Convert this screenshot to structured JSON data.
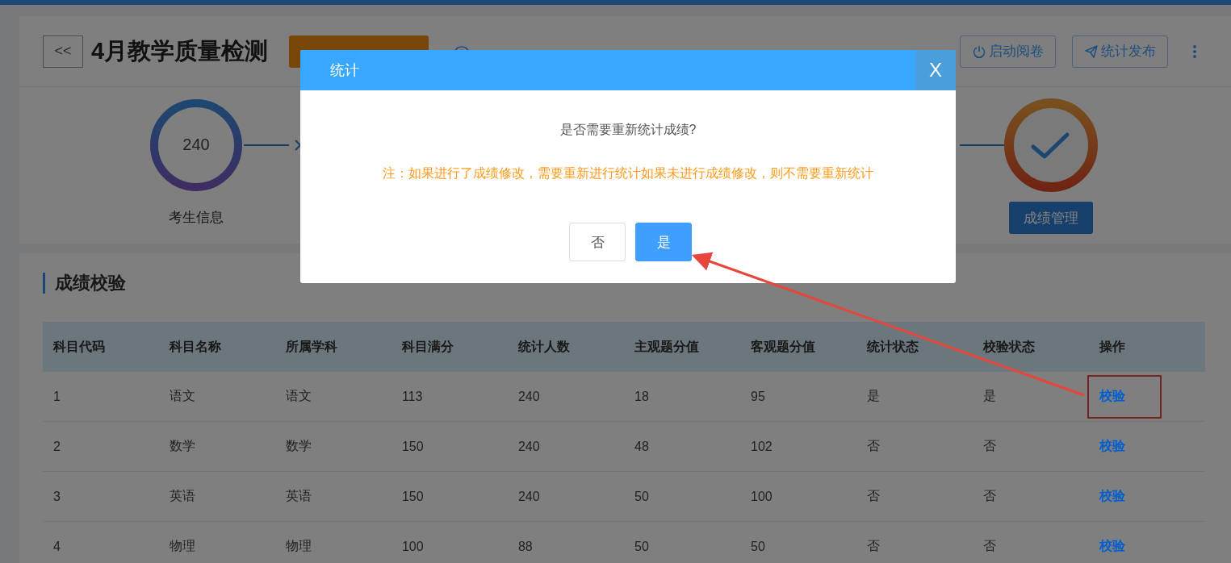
{
  "header": {
    "back_button": "<<",
    "title": "4月教学质量检测",
    "actions": [
      {
        "kind": "power",
        "label": "启动阅卷"
      },
      {
        "kind": "send",
        "label": "统计发布"
      }
    ]
  },
  "steps": [
    {
      "kind": "count",
      "value": "240",
      "label": "考生信息"
    },
    {
      "kind": "done",
      "button": "成绩管理"
    }
  ],
  "section_title": "成绩校验",
  "table": {
    "columns": [
      "科目代码",
      "科目名称",
      "所属学科",
      "科目满分",
      "统计人数",
      "主观题分值",
      "客观题分值",
      "统计状态",
      "校验状态",
      "操作"
    ],
    "rows": [
      {
        "cells": [
          "1",
          "语文",
          "语文",
          "113",
          "240",
          "18",
          "95",
          "是",
          "是"
        ],
        "action": "校验",
        "highlighted": true
      },
      {
        "cells": [
          "2",
          "数学",
          "数学",
          "150",
          "240",
          "48",
          "102",
          "否",
          "否"
        ],
        "action": "校验",
        "highlighted": false
      },
      {
        "cells": [
          "3",
          "英语",
          "英语",
          "150",
          "240",
          "50",
          "100",
          "否",
          "否"
        ],
        "action": "校验",
        "highlighted": false
      },
      {
        "cells": [
          "4",
          "物理",
          "物理",
          "100",
          "88",
          "50",
          "50",
          "否",
          "否"
        ],
        "action": "校验",
        "highlighted": false
      }
    ]
  },
  "dialog": {
    "title": "统计",
    "close": "X",
    "question": "是否需要重新统计成绩?",
    "note": "注：如果进行了成绩修改，需要重新进行统计如果未进行成绩修改，则不需要重新统计",
    "buttons": [
      {
        "label": "否",
        "primary": false
      },
      {
        "label": "是",
        "primary": true
      }
    ]
  }
}
